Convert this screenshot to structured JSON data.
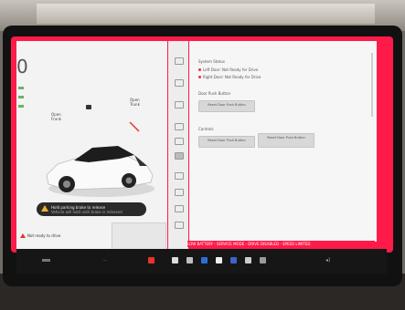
{
  "left_panel": {
    "speed_digit": "0",
    "callout_frunk": "Open\nFrunk",
    "callout_trunk": "Open\nTrunk",
    "alert_title": "Hold parking brake to release",
    "alert_subtitle": "Vehicle will hold until brake is released",
    "warning_text": "Not ready to drive"
  },
  "settings": {
    "section_title": "System Status",
    "status_line_1": "Left Door: Not Ready for Drive",
    "status_line_2": "Right Door: Not Ready for Drive",
    "sub_title": "Door Push Button",
    "btn_reset": "Reset Door Push Button",
    "sub_title_2": "Controls",
    "btn_controls": "Reset Door Push Button",
    "btn_controls_2": "Reset Door Push Button"
  },
  "status_bar": {
    "text": "LOW BATTERY  -  SERVICE MODE  -  DRIVE DISABLED  -  SPEED LIMITED"
  },
  "taskbar": {
    "temp_left": "--",
    "volume": "◂)"
  },
  "colors": {
    "service_border": "#ff1a4a",
    "alert_red": "#e8332c",
    "alert_amber": "#f0b22a"
  }
}
